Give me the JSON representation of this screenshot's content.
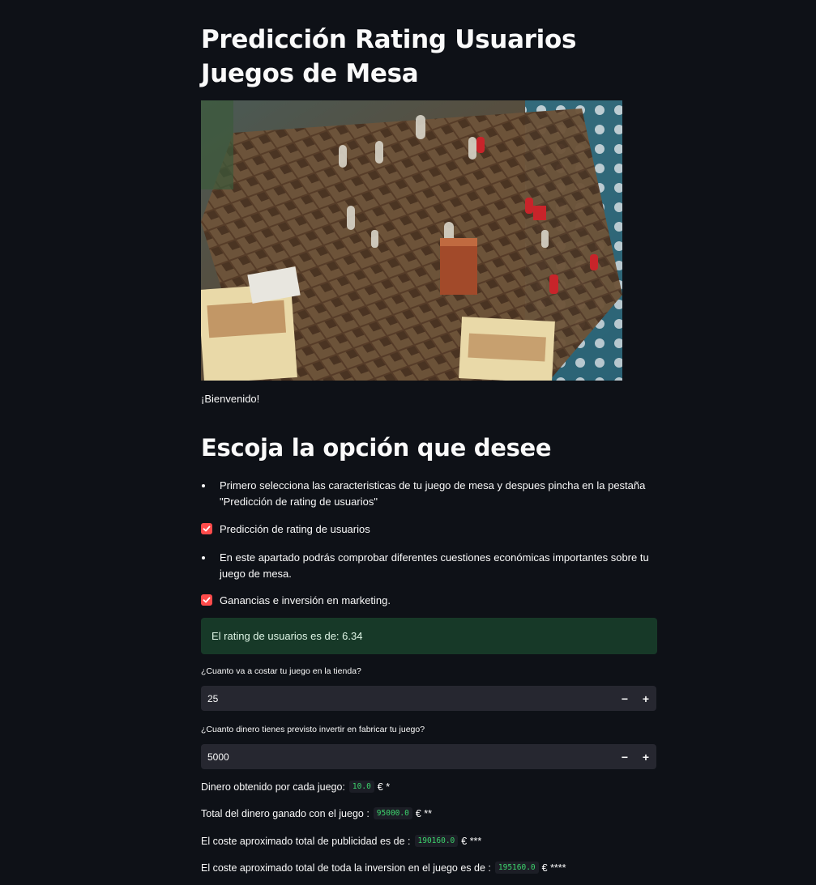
{
  "page": {
    "title": "Predicción Rating Usuarios Juegos de Mesa",
    "welcome": "¡Bienvenido!",
    "subtitle": "Escoja la opción que desee"
  },
  "options": {
    "bullet1": "Primero selecciona las caracteristicas de tu juego de mesa y despues pincha en la pestaña \"Predicción de rating de usuarios\"",
    "checkbox1_label": "Predicción de rating de usuarios",
    "checkbox1_checked": true,
    "bullet2": "En este apartado podrás comprobar diferentes cuestiones económicas importantes sobre tu juego de mesa.",
    "checkbox2_label": "Ganancias e inversión en marketing.",
    "checkbox2_checked": true
  },
  "prediction": {
    "message": "El rating de usuarios es de: 6.34"
  },
  "inputs": {
    "price_label": "¿Cuanto va a costar tu juego en la tienda?",
    "price_value": "25",
    "investment_label": "¿Cuanto dinero tienes previsto invertir en fabricar tu juego?",
    "investment_value": "5000",
    "minus": "−",
    "plus": "+"
  },
  "results": {
    "per_game_label": "Dinero obtenido por cada juego:",
    "per_game_value": "10.0",
    "per_game_suffix": "€ *",
    "total_label": "Total del dinero ganado con el juego :",
    "total_value": "95000.0",
    "total_suffix": "€ **",
    "ad_cost_label": "El coste aproximado total de publicidad es de :",
    "ad_cost_value": "190160.0",
    "ad_cost_suffix": "€ ***",
    "invest_label": "El coste aproximado total de toda la inversion en el juego es de :",
    "invest_value": "195160.0",
    "invest_suffix": "€ ****"
  },
  "colors": {
    "background": "#0e1117",
    "checkbox": "#ff4b4b",
    "success_bg": "#173928",
    "input_bg": "#262730",
    "code_text": "#3dd56d"
  }
}
